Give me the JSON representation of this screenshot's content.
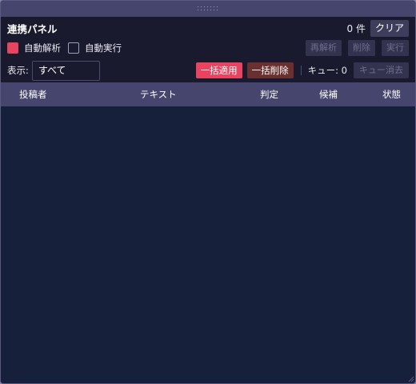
{
  "panel": {
    "title": "連携パネル",
    "count": "0 件",
    "clear_label": "クリア"
  },
  "toolbar": {
    "auto_analyze_label": "自動解析",
    "auto_analyze_checked": true,
    "auto_execute_label": "自動実行",
    "auto_execute_checked": false,
    "reanalyze_label": "再解析",
    "delete_label": "削除",
    "execute_label": "実行"
  },
  "filter": {
    "display_label": "表示:",
    "selected": "すべて",
    "bulk_apply_label": "一括適用",
    "bulk_delete_label": "一括削除",
    "queue_label": "キュー: 0",
    "queue_clear_label": "キュー消去"
  },
  "table": {
    "columns": [
      "投稿者",
      "テキスト",
      "判定",
      "候補",
      "状態"
    ],
    "rows": []
  },
  "colors": {
    "accent": "#e8445f",
    "danger": "#6a3030",
    "header_bg": "#45456e",
    "body_bg": "#16203a"
  }
}
